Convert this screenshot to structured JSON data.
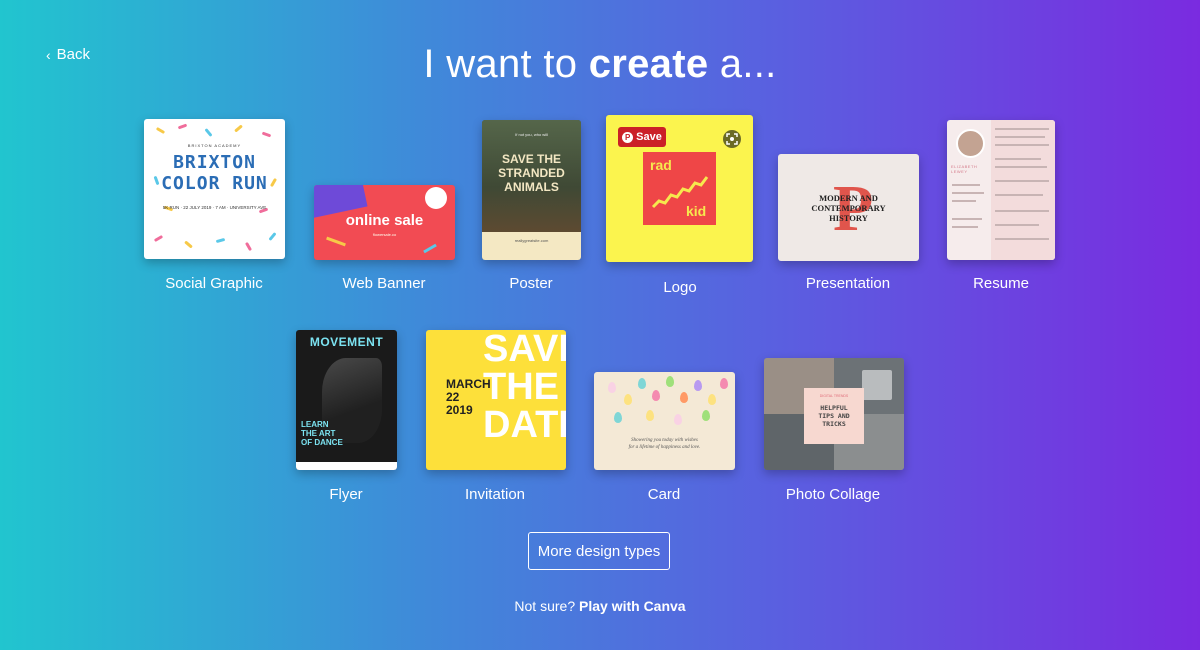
{
  "nav": {
    "back_label": "Back"
  },
  "header": {
    "title_prefix": "I want to ",
    "title_bold": "create",
    "title_suffix": " a..."
  },
  "design_types": [
    {
      "label": "Social Graphic",
      "thumb": {
        "kicker": "BRIXTON ACADEMY",
        "title_line1": "BRIXTON",
        "title_line2": "COLOR RUN",
        "details": "5K RUN · 22 JULY 2019 · 7 AM · UNIVERSITY AVE"
      }
    },
    {
      "label": "Web Banner",
      "thumb": {
        "title": "online sale",
        "sub": "flowersale.co"
      }
    },
    {
      "label": "Poster",
      "thumb": {
        "kicker": "If not you, who will",
        "title_line1": "SAVE THE",
        "title_line2": "STRANDED",
        "title_line3": "ANIMALS",
        "footer": "reallygreatsite.com"
      }
    },
    {
      "label": "Logo",
      "thumb": {
        "word1": "rad",
        "word2": "kid"
      },
      "overlay": {
        "pin_label": "Save"
      }
    },
    {
      "label": "Presentation",
      "thumb": {
        "letter": "P",
        "title_line1": "MODERN AND",
        "title_line2": "CONTEMPORARY",
        "title_line3": "HISTORY"
      }
    },
    {
      "label": "Resume",
      "thumb": {
        "name": "ELIZABETH LEWEY"
      }
    },
    {
      "label": "Flyer",
      "thumb": {
        "title": "MOVEMENT",
        "body_line1": "LEARN",
        "body_line2": "THE ART",
        "body_line3": "OF DANCE"
      }
    },
    {
      "label": "Invitation",
      "thumb": {
        "big_line1": "SAVE",
        "big_line2": "THE",
        "big_line3": "DATE",
        "date_line1": "MARCH",
        "date_line2": "22",
        "date_line3": "2019"
      }
    },
    {
      "label": "Card",
      "thumb": {
        "text_line1": "Showering you today with wishes",
        "text_line2": "for a lifetime of happiness and love."
      }
    },
    {
      "label": "Photo Collage",
      "thumb": {
        "kicker": "DIGITAL TRENDS",
        "title_line1": "HELPFUL",
        "title_line2": "TIPS AND",
        "title_line3": "TRICKS"
      }
    }
  ],
  "more_button": {
    "label": "More design types"
  },
  "footer": {
    "prefix": "Not sure? ",
    "link": "Play with Canva"
  },
  "colors": {
    "gradient_start": "#21c5cf",
    "gradient_end": "#7a2be0",
    "pin_red": "#cb2027"
  }
}
